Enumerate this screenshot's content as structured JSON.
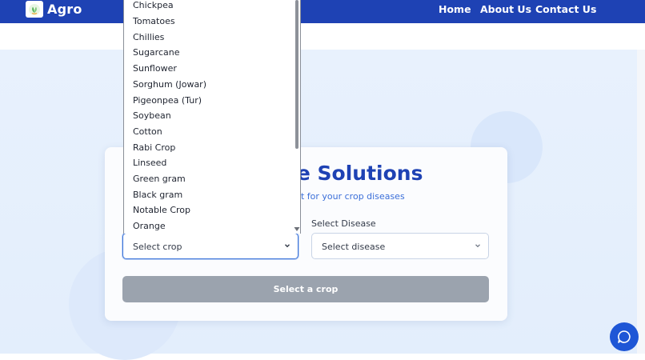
{
  "header": {
    "brand": "Agro",
    "nav": [
      {
        "label": "Home"
      },
      {
        "label": "About Us"
      },
      {
        "label": "Contact Us"
      }
    ]
  },
  "card": {
    "title": "se Solutions",
    "subtitle": "nt for your crop diseases",
    "disease_label": "Select Disease",
    "crop_select_value": "Select crop",
    "disease_select_value": "Select disease",
    "submit_label": "Select a crop"
  },
  "dropdown": {
    "options": [
      "Chickpea",
      "Tomatoes",
      "Chillies",
      "Sugarcane",
      "Sunflower",
      "Sorghum (Jowar)",
      "Pigeonpea (Tur)",
      "Soybean",
      "Cotton",
      "Rabi Crop",
      "Linseed",
      "Green gram",
      "Black gram",
      "Notable Crop",
      "Orange"
    ]
  },
  "colors": {
    "brand": "#1e42b4",
    "accent": "#3b73d9",
    "button_disabled": "#9ba3ae"
  },
  "icons": {
    "logo": "leaf-logo-icon",
    "chevron": "chevron-down-icon",
    "chat": "chat-bubble-icon"
  }
}
